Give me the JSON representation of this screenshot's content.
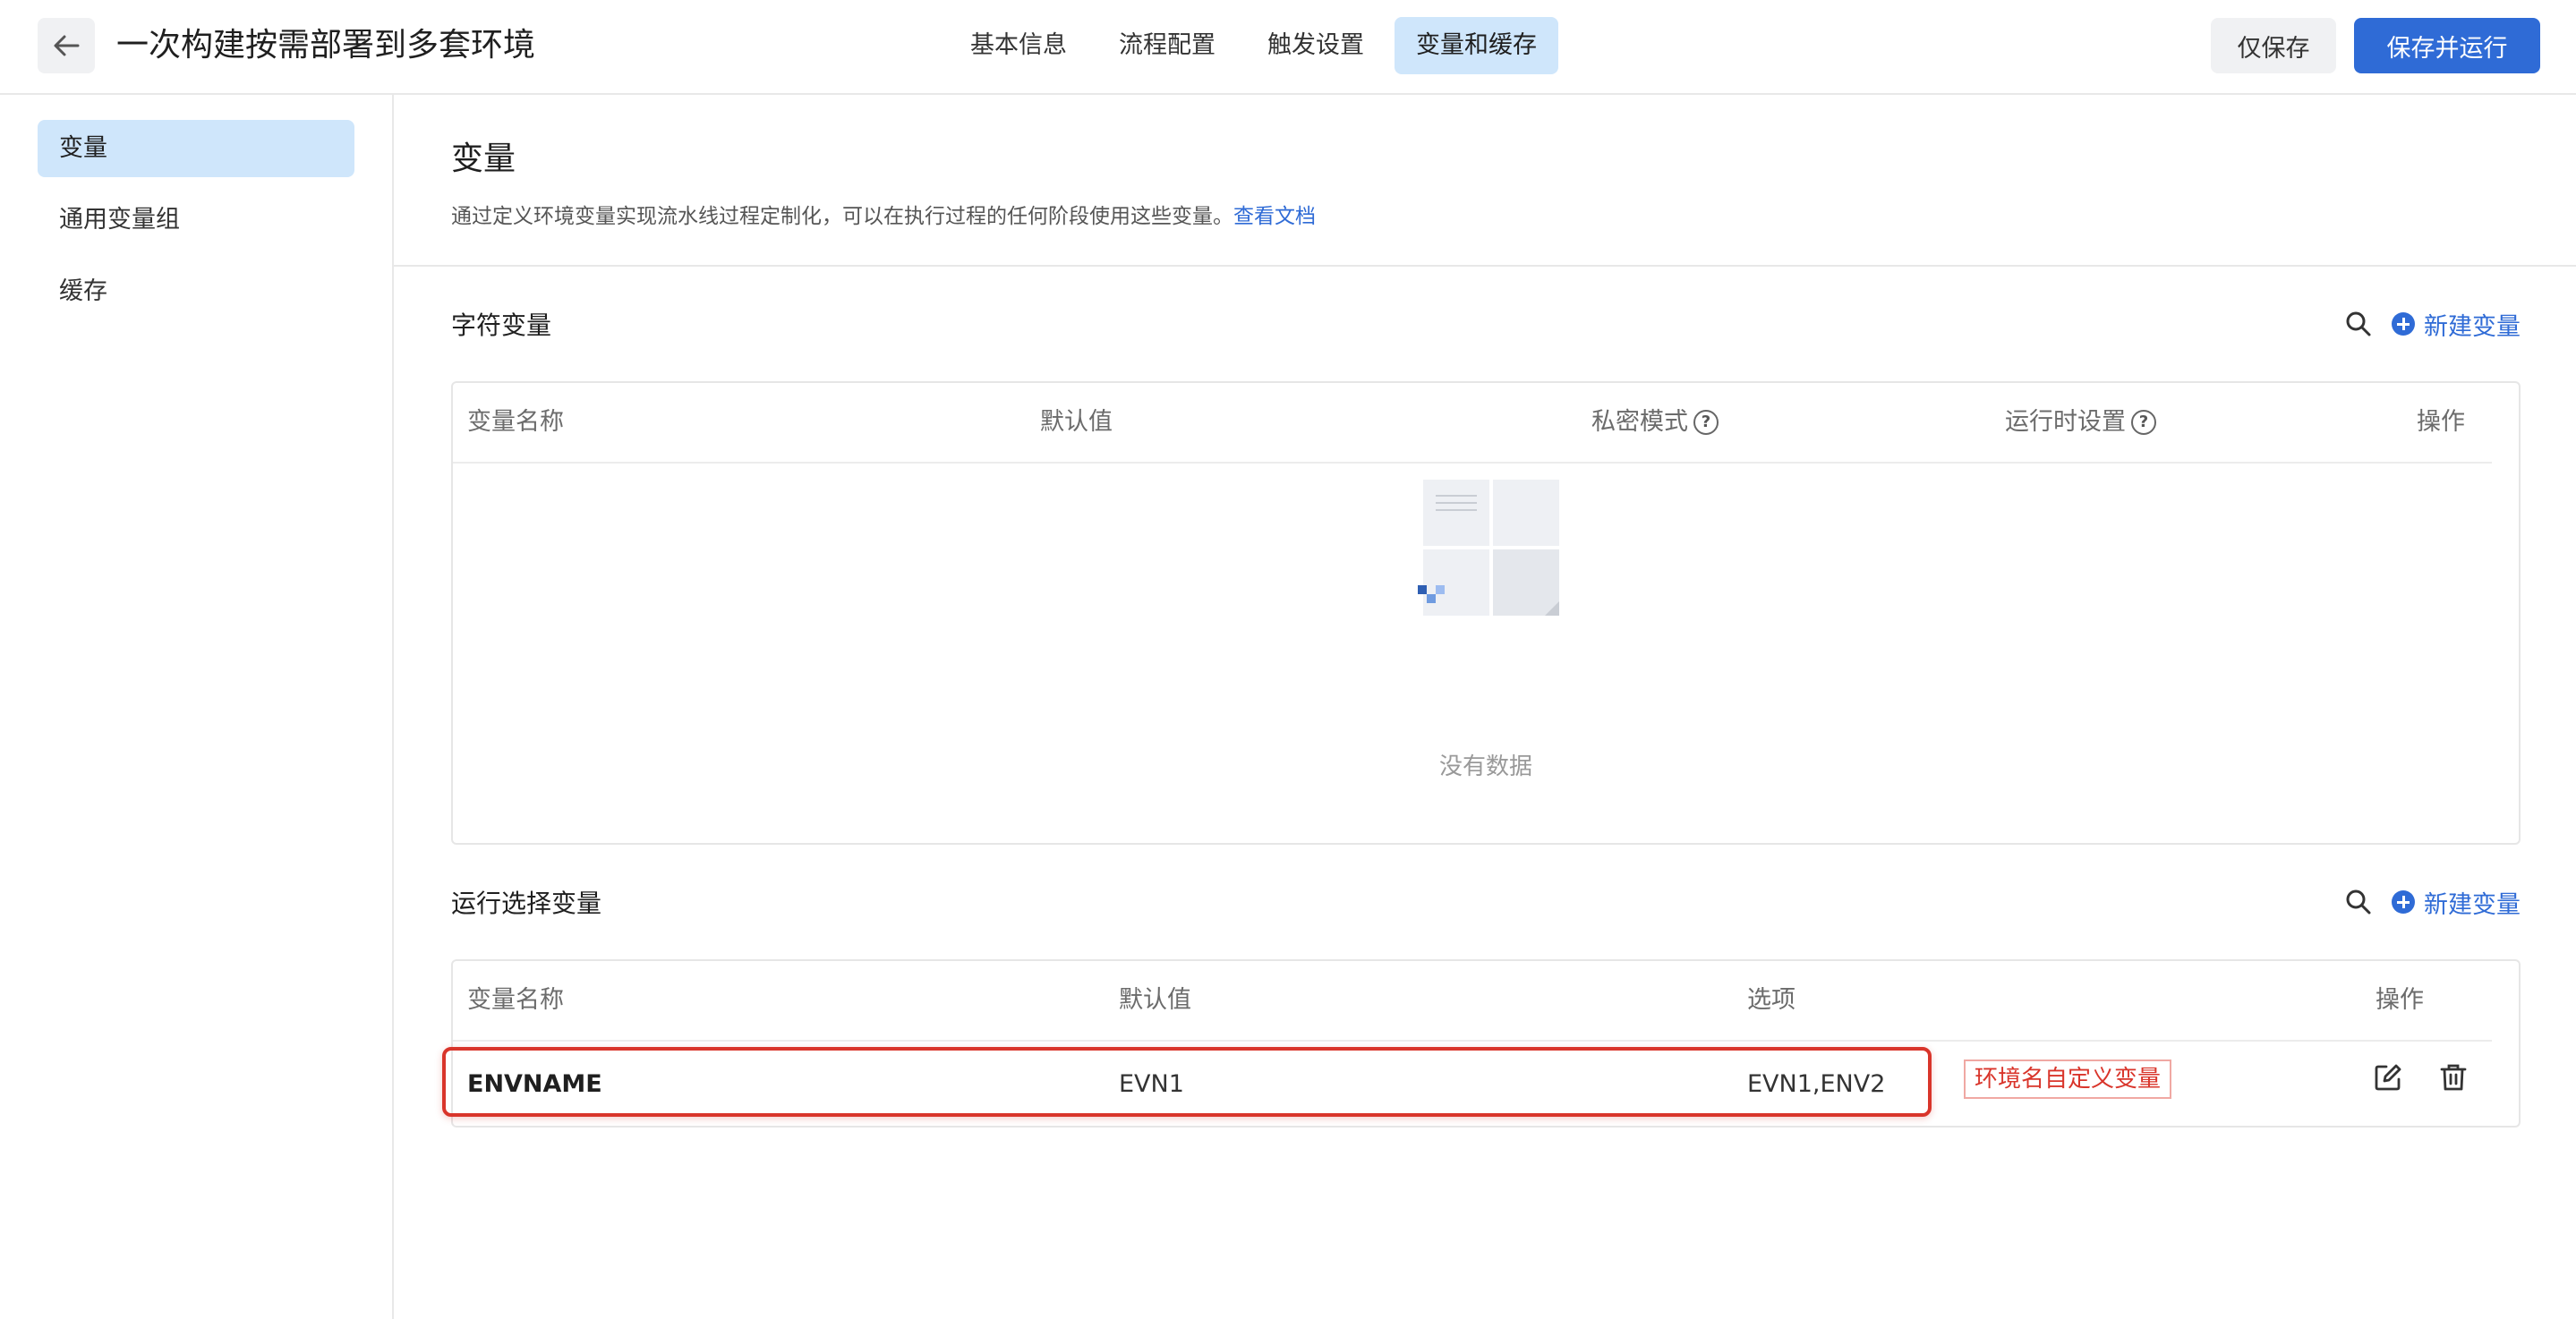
{
  "header": {
    "title": "一次构建按需部署到多套环境",
    "tabs": [
      {
        "label": "基本信息",
        "active": false
      },
      {
        "label": "流程配置",
        "active": false
      },
      {
        "label": "触发设置",
        "active": false
      },
      {
        "label": "变量和缓存",
        "active": true
      }
    ],
    "save_only_label": "仅保存",
    "save_run_label": "保存并运行"
  },
  "sidebar": {
    "items": [
      {
        "label": "变量",
        "active": true
      },
      {
        "label": "通用变量组",
        "active": false
      },
      {
        "label": "缓存",
        "active": false
      }
    ]
  },
  "main": {
    "title": "变量",
    "description": "通过定义环境变量实现流水线过程定制化，可以在执行过程的任何阶段使用这些变量。",
    "doc_link": "查看文档"
  },
  "string_vars": {
    "title": "字符变量",
    "new_label": "新建变量",
    "columns": [
      "变量名称",
      "默认值",
      "私密模式",
      "运行时设置",
      "操作"
    ],
    "empty_text": "没有数据"
  },
  "select_vars": {
    "title": "运行选择变量",
    "new_label": "新建变量",
    "columns": [
      "变量名称",
      "默认值",
      "选项",
      "操作"
    ],
    "rows": [
      {
        "name": "ENVNAME",
        "default": "EVN1",
        "options": "EVN1,ENV2"
      }
    ]
  },
  "annotation": {
    "text": "环境名自定义变量"
  },
  "colors": {
    "accent": "#2f6bd6",
    "active_bg": "#cfe6fb",
    "highlight": "#d9352b"
  },
  "icons": [
    "arrow-left-icon",
    "search-icon",
    "plus-circle-icon",
    "help-icon",
    "edit-icon",
    "delete-icon",
    "empty-state-illustration"
  ]
}
